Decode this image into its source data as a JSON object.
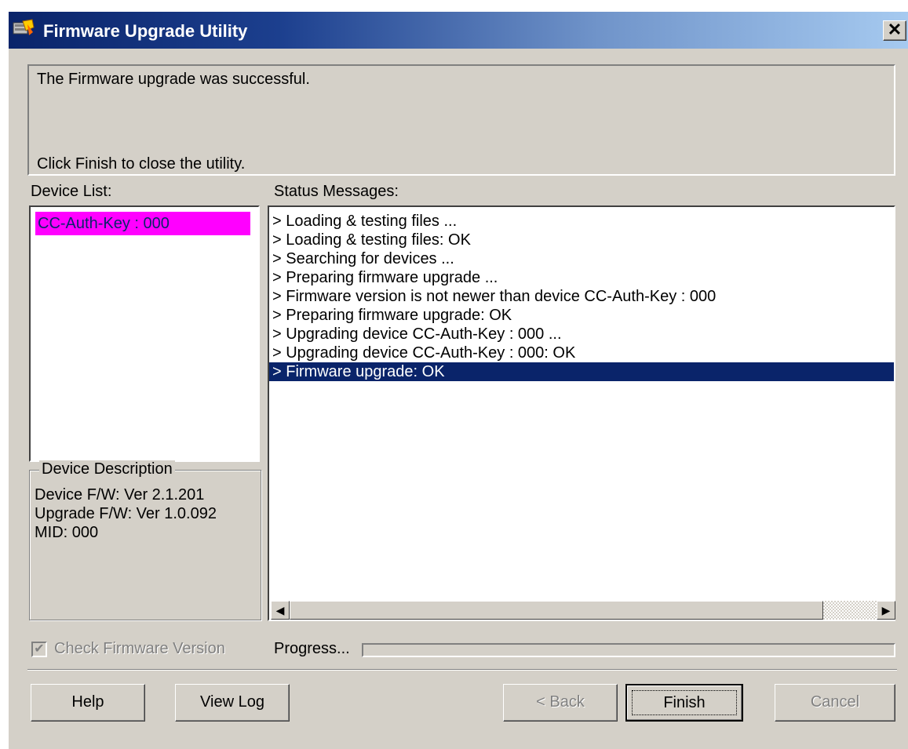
{
  "window": {
    "title": "Firmware Upgrade Utility",
    "close_glyph": "✕",
    "icon": "firmware-app-icon"
  },
  "message": {
    "line1": "The Firmware upgrade was successful.",
    "line2": "Click Finish to close the utility."
  },
  "device_list": {
    "label": "Device List:",
    "items": [
      "CC-Auth-Key : 000"
    ],
    "selected_color": "#ff00ff"
  },
  "device_description": {
    "legend": "Device Description",
    "lines": [
      "Device F/W: Ver 2.1.201",
      "Upgrade F/W: Ver 1.0.092",
      "MID: 000"
    ]
  },
  "status": {
    "label": "Status Messages:",
    "lines": [
      "> Loading & testing files ...",
      "> Loading & testing files: OK",
      "> Searching for devices ...",
      "> Preparing firmware upgrade ...",
      "> Firmware version is not newer than device CC-Auth-Key : 000",
      "> Preparing firmware upgrade: OK",
      "> Upgrading device CC-Auth-Key : 000 ...",
      "> Upgrading device CC-Auth-Key : 000: OK",
      "> Firmware upgrade: OK"
    ],
    "selected_index": 8,
    "selection_color": "#0a246a"
  },
  "check_firmware": {
    "label": "Check Firmware Version",
    "checked": true,
    "enabled": false
  },
  "progress": {
    "label": "Progress...",
    "value": 0
  },
  "buttons": {
    "help": "Help",
    "view_log": "View Log",
    "back": "< Back",
    "finish": "Finish",
    "cancel": "Cancel"
  },
  "scrollbar": {
    "left_arrow": "◀",
    "right_arrow": "▶"
  }
}
